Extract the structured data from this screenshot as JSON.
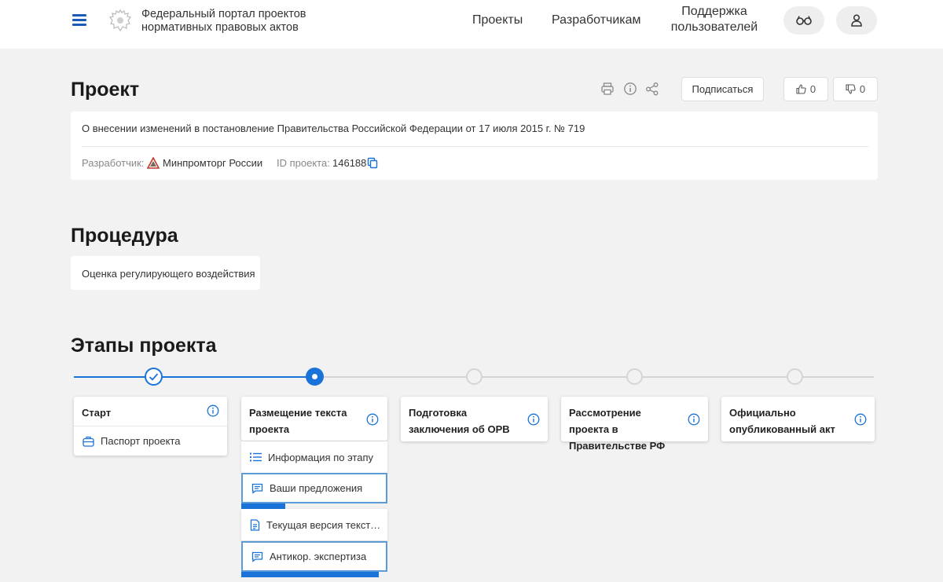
{
  "header": {
    "portal_title_line1": "Федеральный портал проектов",
    "portal_title_line2": "нормативных правовых актов",
    "nav": {
      "projects": "Проекты",
      "developers": "Разработчикам",
      "support_line1": "Поддержка",
      "support_line2": "пользователей"
    }
  },
  "project": {
    "heading": "Проект",
    "subscribe_label": "Подписаться",
    "likes": "0",
    "dislikes": "0",
    "description": "О внесении изменений в постановление Правительства Российской Федерации от 17 июля 2015 г. № 719",
    "developer_label": "Разработчик:",
    "developer_name": "Минпромторг России",
    "id_label": "ID проекта:",
    "id_value": "146188"
  },
  "procedure": {
    "heading": "Процедура",
    "value": "Оценка регулирующего воздействия"
  },
  "stages": {
    "heading": "Этапы проекта",
    "items": [
      {
        "title": "Старт",
        "status": "done",
        "sub_items": [
          "Паспорт проекта"
        ]
      },
      {
        "title": "Размещение текста проекта",
        "status": "active",
        "sub_items": [
          "Информация по этапу",
          "Ваши предложения",
          "Текущая версия текста проекта",
          "Антикор. экспертиза"
        ]
      },
      {
        "title": "Подготовка заключения об ОРВ",
        "status": "future"
      },
      {
        "title": "Рассмотрение проекта в Правительстве РФ",
        "status": "future"
      },
      {
        "title": "Официально опубликованный акт",
        "status": "future"
      }
    ],
    "progress": {
      "proposals": 0.3,
      "anticor": 0.94
    }
  },
  "colors": {
    "accent": "#1a73d8",
    "nav_icon": "#1a5bb8",
    "background": "#f2f2f2",
    "card": "#ffffff"
  },
  "icons": {
    "menu": "hamburger-icon",
    "emblem": "coat-of-arms-icon",
    "glasses": "glasses-icon",
    "user": "user-icon",
    "print": "printer-icon",
    "info": "info-icon",
    "share": "share-icon",
    "like": "thumbs-up-icon",
    "dislike": "thumbs-down-icon",
    "copy": "copy-icon"
  }
}
